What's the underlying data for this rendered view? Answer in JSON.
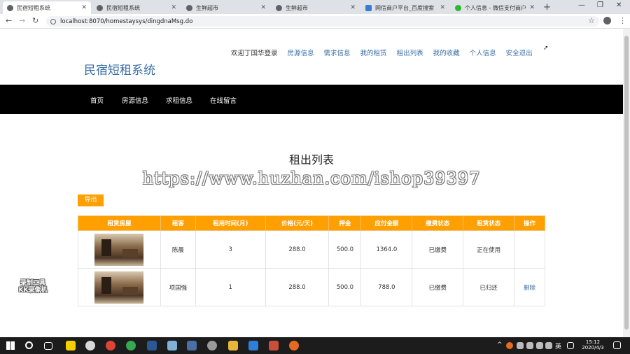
{
  "browser": {
    "tabs": [
      {
        "label": "民宿短租系统",
        "active": true,
        "icon": "globe-icon"
      },
      {
        "label": "民宿短租系统",
        "active": false,
        "icon": "globe-icon"
      },
      {
        "label": "生鲜超市",
        "active": false,
        "icon": "globe-icon"
      },
      {
        "label": "生鲜超市",
        "active": false,
        "icon": "globe-icon"
      },
      {
        "label": "网信商户平台_百度搜索",
        "active": false,
        "icon": "baidu-icon"
      },
      {
        "label": "个人信息 - 微信支付商户平台",
        "active": false,
        "icon": "wechat-icon"
      }
    ],
    "url": "localhost:8070/homestaysys/dingdnaMsg.do"
  },
  "site": {
    "title": "民宿短租系统",
    "welcome": "欢迎丁国华登录",
    "topnav": [
      "房源信息",
      "需求信息",
      "我的租赁",
      "租出列表",
      "我的收藏",
      "个人信息",
      "安全退出"
    ],
    "mainnav": [
      "首页",
      "房源信息",
      "求租信息",
      "在线留言"
    ]
  },
  "page": {
    "title": "租出列表",
    "watermark": "https://www.huzhan.com/ishop39397",
    "export_label": "导出"
  },
  "table": {
    "headers": [
      "租赁房屋",
      "租客",
      "租用时间(月)",
      "价格(元/天)",
      "押金",
      "应付金额",
      "缴费状态",
      "租赁状态",
      "操作"
    ],
    "rows": [
      {
        "tenant": "陈晨",
        "months": "3",
        "price": "288.0",
        "deposit": "500.0",
        "amount": "1364.0",
        "pay_status": "已缴费",
        "rent_status": "正在使用",
        "action": ""
      },
      {
        "tenant": "项国强",
        "months": "1",
        "price": "288.0",
        "deposit": "500.0",
        "amount": "788.0",
        "pay_status": "已缴费",
        "rent_status": "已归还",
        "action": "删除"
      }
    ]
  },
  "overlay": {
    "recorder_line1": "录制工具",
    "recorder_line2": "KK录像机"
  },
  "taskbar": {
    "lang": "英",
    "time": "15:12",
    "date": "2020/4/3"
  },
  "colors": {
    "accent": "#ff9f00",
    "link": "#3a6ea5",
    "nav_bg": "#000000"
  }
}
